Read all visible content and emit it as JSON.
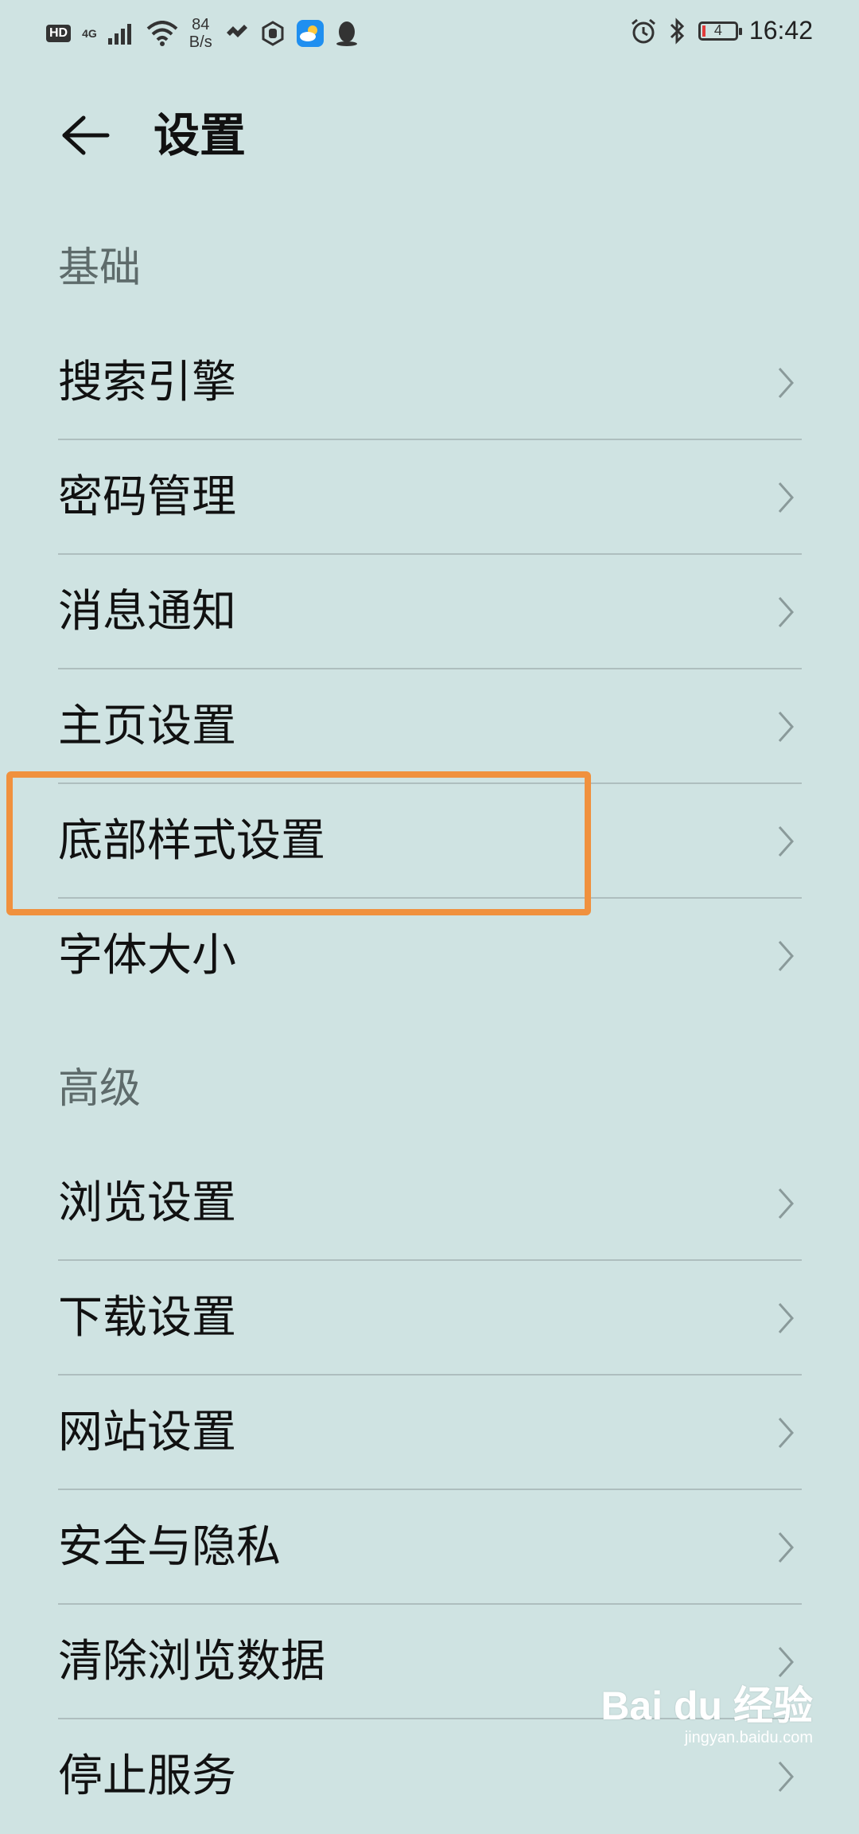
{
  "status_bar": {
    "hd": "HD",
    "network": "4G",
    "speed_value": "84",
    "speed_unit": "B/s",
    "battery_level": "4",
    "time": "16:42"
  },
  "header": {
    "title": "设置"
  },
  "sections": {
    "basic": {
      "title": "基础",
      "items": [
        "搜索引擎",
        "密码管理",
        "消息通知",
        "主页设置",
        "底部样式设置",
        "字体大小"
      ]
    },
    "advanced": {
      "title": "高级",
      "items": [
        "浏览设置",
        "下载设置",
        "网站设置",
        "安全与隐私",
        "清除浏览数据",
        "停止服务"
      ]
    }
  },
  "watermark": {
    "brand": "Bai du 经验",
    "url": "jingyan.baidu.com"
  },
  "colors": {
    "background": "#cfe3e2",
    "highlight": "#f0913e",
    "divider": "#aebebe",
    "section_title": "#5e6b6b"
  }
}
